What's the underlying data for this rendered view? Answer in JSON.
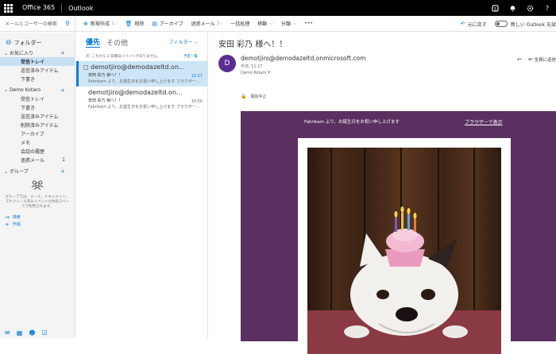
{
  "topbar": {
    "brand": "Office 365",
    "app": "Outlook"
  },
  "search": {
    "placeholder": "メールとユーザーの検索"
  },
  "toolbar": {
    "new": "新規作成",
    "delete": "削除",
    "archive": "アーカイブ",
    "junk": "迷惑メール",
    "sweep": "一括処理",
    "move": "移動",
    "categorize": "分類",
    "more": "•••",
    "undo": "元に戻す",
    "new_outlook": "新しい Outlook を試"
  },
  "nav": {
    "folders_label": "フォルダー",
    "favorites": "お気に入り",
    "favorites_items": [
      "受信トレイ",
      "送信済みアイテム",
      "下書き"
    ],
    "account": "Demo Kotaro",
    "account_items": [
      {
        "label": "受信トレイ",
        "count": ""
      },
      {
        "label": "下書き",
        "count": ""
      },
      {
        "label": "送信済みアイテム",
        "count": ""
      },
      {
        "label": "削除済みアイテム",
        "count": ""
      },
      {
        "label": "アーカイブ",
        "count": ""
      },
      {
        "label": "メモ",
        "count": ""
      },
      {
        "label": "会話の履歴",
        "count": ""
      },
      {
        "label": "迷惑メール",
        "count": "1"
      }
    ],
    "groups": "グループ",
    "groups_text": "グループでは、メール、ドキュメント、スケジュール済みイベントが共有スペースで利用されます。",
    "groups_actions": [
      "検索",
      "作成"
    ]
  },
  "list": {
    "tab_focused": "優先",
    "tab_other": "その他",
    "filter": "フィルター",
    "info": "次: これから 2 日間はイベントがありません。",
    "info_action": "予定一覧",
    "items": [
      {
        "from": "demotjiro@demodazeltd.on...",
        "subject": "安田 彩乃 様へ！！",
        "preview": "Fabrikam より、お誕生日をお祝い申し上げます ブラウザー…",
        "time": "11:17"
      },
      {
        "from": "demotjiro@demodazeltd.on...",
        "subject": "安田 彩乃 様へ！！",
        "preview": "Fabrikam より、お誕生日をお祝い申し上げます ブラウザー…",
        "time": "10:50"
      }
    ]
  },
  "reading": {
    "title": "安田 彩乃 様へ！！",
    "avatar_letter": "D",
    "sender": "demotjiro@demodazeltd.onmicrosoft.com",
    "date": "今日, 11:17",
    "to": "Demo Kotaro ¥",
    "reply_all": "全員に返信",
    "block_label": "開始中止",
    "banner_text": "Fabrikam より、お誕生日をお祝い申し上げます",
    "banner_link": "ブラウザーで表示"
  },
  "colors": {
    "accent": "#0078d7",
    "banner": "#5b3060",
    "avatar": "#5c2d91",
    "selected": "#cde6f7"
  }
}
